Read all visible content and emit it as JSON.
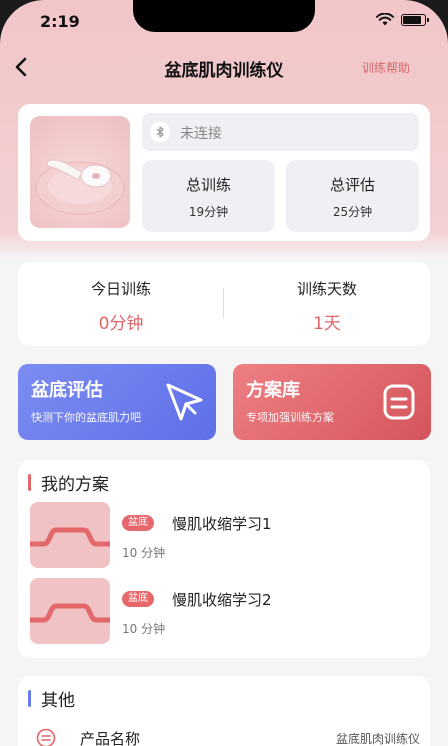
{
  "status": {
    "time": "2:19"
  },
  "nav": {
    "title": "盆底肌肉训练仪",
    "help": "训练帮助"
  },
  "device": {
    "connection_status": "未连接",
    "stats": [
      {
        "label": "总训练",
        "value": "19分钟"
      },
      {
        "label": "总评估",
        "value": "25分钟"
      }
    ]
  },
  "today": {
    "items": [
      {
        "label": "今日训练",
        "value": "0分钟"
      },
      {
        "label": "训练天数",
        "value": "1天"
      }
    ]
  },
  "features": [
    {
      "title": "盆底评估",
      "subtitle": "快测下你的盆底肌力吧",
      "icon": "cursor-arrow-icon",
      "color": "#6a7bee"
    },
    {
      "title": "方案库",
      "subtitle": "专项加强训练方案",
      "icon": "library-icon",
      "color": "#e06a70"
    }
  ],
  "plans": {
    "title": "我的方案",
    "items": [
      {
        "badge": "盆底",
        "name": "慢肌收缩学习1",
        "duration": "10 分钟"
      },
      {
        "badge": "盆底",
        "name": "慢肌收缩学习2",
        "duration": "10 分钟"
      }
    ]
  },
  "other": {
    "title": "其他",
    "rows": [
      {
        "label": "产品名称",
        "value": "盆底肌肉训练仪",
        "icon": "product-icon"
      }
    ]
  },
  "colors": {
    "accent": "#e0666a",
    "primary_blue": "#6a7bee",
    "header_pink": "#f2c6c8"
  }
}
